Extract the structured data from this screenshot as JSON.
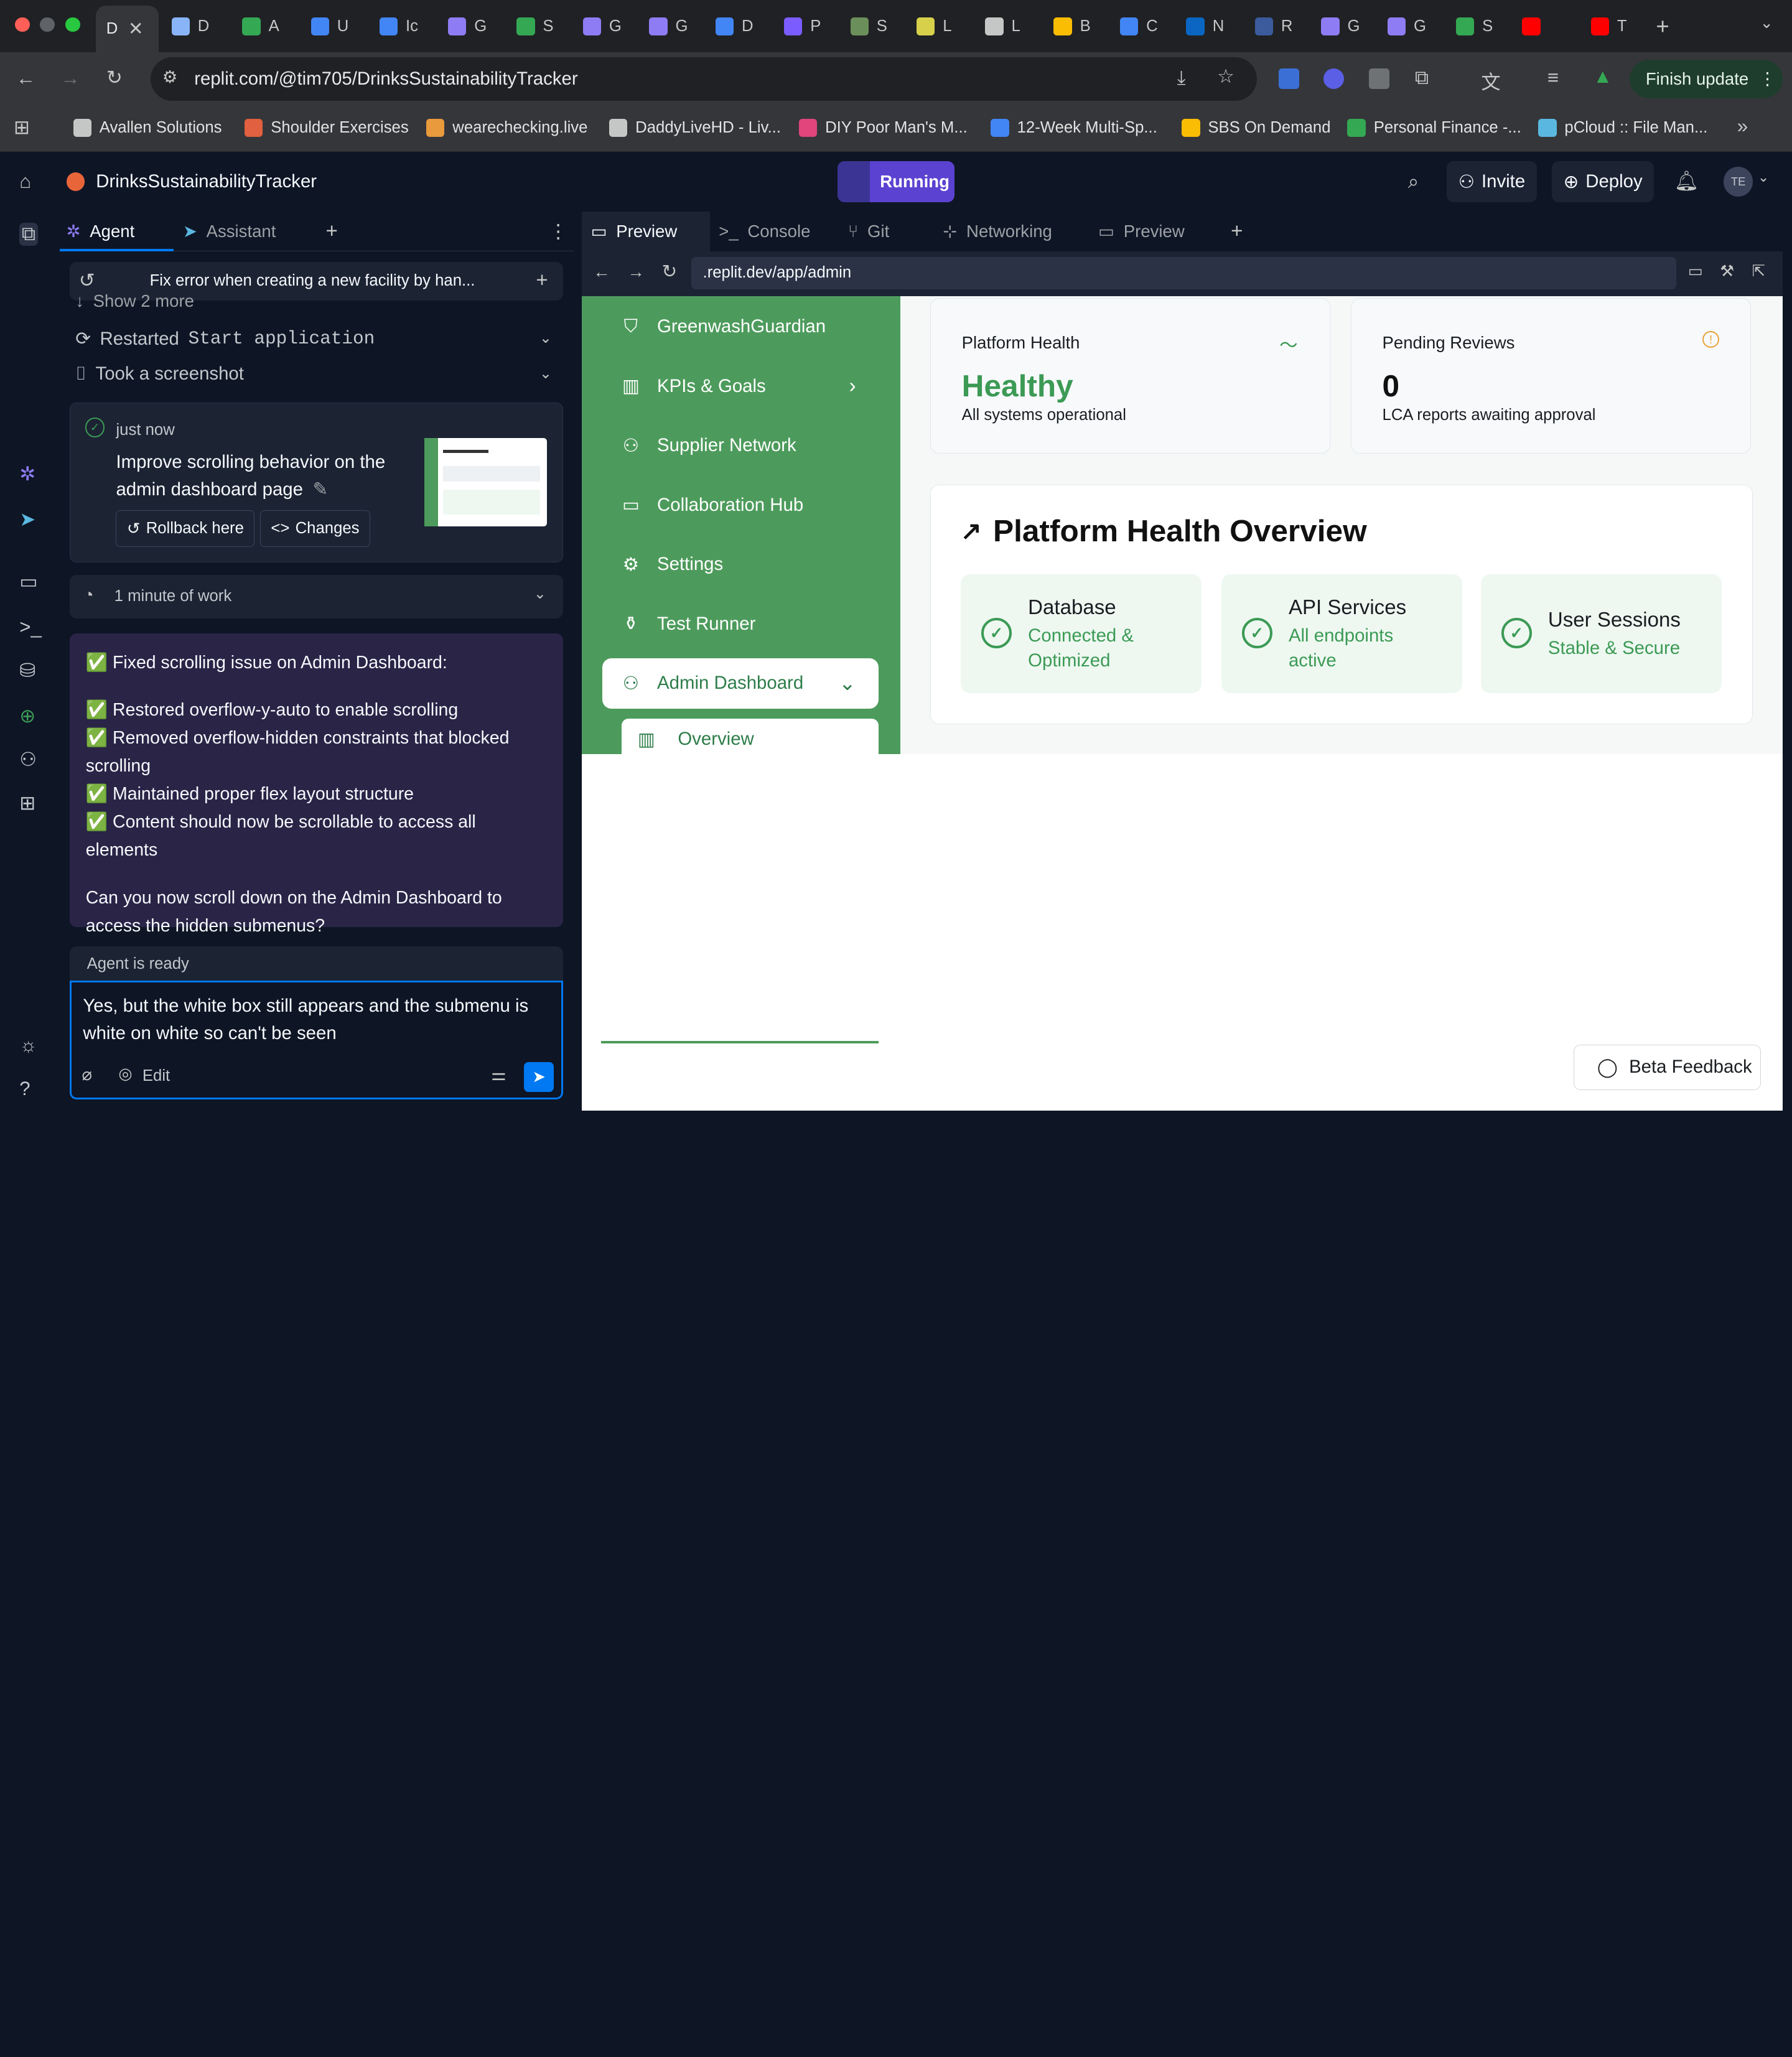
{
  "browser": {
    "tabs": [
      {
        "label": "D",
        "color": "#c4c7c5"
      },
      {
        "label": "D",
        "color": "#8ab4f8"
      },
      {
        "label": "A",
        "color": "#34a853"
      },
      {
        "label": "U",
        "color": "#4285f4"
      },
      {
        "label": "Ic",
        "color": "#4285f4"
      },
      {
        "label": "G",
        "color": "#8e7cf4"
      },
      {
        "label": "S",
        "color": "#34a853"
      },
      {
        "label": "G",
        "color": "#8e7cf4"
      },
      {
        "label": "G",
        "color": "#8e7cf4"
      },
      {
        "label": "D",
        "color": "#4285f4"
      },
      {
        "label": "P",
        "color": "#7b5cff"
      },
      {
        "label": "S",
        "color": "#6b8f5a"
      },
      {
        "label": "L",
        "color": "#d6d04a"
      },
      {
        "label": "L",
        "color": "#c4c7c5"
      },
      {
        "label": "B",
        "color": "#fbbc04"
      },
      {
        "label": "C",
        "color": "#4285f4"
      },
      {
        "label": "N",
        "color": "#0a66c2"
      },
      {
        "label": "R",
        "color": "#3b5b9c"
      },
      {
        "label": "G",
        "color": "#8e7cf4"
      },
      {
        "label": "G",
        "color": "#8e7cf4"
      },
      {
        "label": "S",
        "color": "#34a853"
      },
      {
        "label": "",
        "color": "#ff0000"
      },
      {
        "label": "T",
        "color": "#ff0000"
      }
    ],
    "url": "replit.com/@tim705/DrinksSustainabilityTracker",
    "finish_update": "Finish update",
    "bookmarks": [
      {
        "label": "Avallen Solutions",
        "color": "#c4c7c5"
      },
      {
        "label": "Shoulder Exercises",
        "color": "#e0603f"
      },
      {
        "label": "wearechecking.live",
        "color": "#e89a3c"
      },
      {
        "label": "DaddyLiveHD - Liv...",
        "color": "#c4c7c5"
      },
      {
        "label": "DIY Poor Man's M...",
        "color": "#e0457b"
      },
      {
        "label": "12-Week Multi-Sp...",
        "color": "#4285f4"
      },
      {
        "label": "SBS On Demand",
        "color": "#fbbc04"
      },
      {
        "label": "Personal Finance -...",
        "color": "#34a853"
      },
      {
        "label": "pCloud :: File Man...",
        "color": "#5ab8e0"
      }
    ]
  },
  "replit": {
    "project_name": "DrinksSustainabilityTracker",
    "run_status": "Running",
    "invite": "Invite",
    "deploy": "Deploy",
    "avatar": "TE"
  },
  "agent": {
    "tabs": [
      "Agent",
      "Assistant"
    ],
    "history_title": "Fix error when creating a new facility by han...",
    "show_more": "Show 2 more",
    "actions": [
      {
        "prefix": "Restarted",
        "code": "Start application"
      },
      {
        "prefix": "Took a screenshot",
        "code": ""
      }
    ],
    "checkpoint": {
      "time": "just now",
      "title": "Improve scrolling behavior on the admin dashboard page",
      "rollback": "Rollback here",
      "changes": "Changes"
    },
    "work": "1 minute of work",
    "message": {
      "heading": "✅ Fixed scrolling issue on Admin Dashboard:",
      "bullets": [
        "✅ Restored overflow-y-auto to enable scrolling",
        "✅ Removed overflow-hidden constraints that blocked scrolling",
        "✅ Maintained proper flex layout structure",
        "✅ Content should now be scrollable to access all elements"
      ],
      "question": "Can you now scroll down on the Admin Dashboard to access the hidden submenus?"
    },
    "status": "Agent is ready",
    "input_text": "Yes, but the white box still appears and the submenu is white on white so can't be seen",
    "edit_label": "Edit"
  },
  "preview": {
    "tabs": [
      "Preview",
      "Console",
      "Git",
      "Networking",
      "Preview"
    ],
    "url": ".replit.dev/app/admin",
    "nav": [
      {
        "label": "GreenwashGuardian",
        "icon": "shield-icon",
        "glyph": "⛉"
      },
      {
        "label": "KPIs & Goals",
        "icon": "factory-icon",
        "glyph": "▥",
        "chevron": "›"
      },
      {
        "label": "Supplier Network",
        "icon": "users-icon",
        "glyph": "⚇"
      },
      {
        "label": "Collaboration Hub",
        "icon": "chat-icon",
        "glyph": "▭"
      },
      {
        "label": "Settings",
        "icon": "gear-icon",
        "glyph": "⚙"
      },
      {
        "label": "Test Runner",
        "icon": "flask-icon",
        "glyph": "⚱"
      },
      {
        "label": "Admin Dashboard",
        "icon": "users-icon",
        "glyph": "⚇",
        "chevron": "⌄"
      }
    ],
    "submenu": {
      "label": "Overview"
    },
    "stats": [
      {
        "heading": "Platform Health",
        "value": "Healthy",
        "sub": "All systems operational",
        "value_color": "#3c9a55",
        "icon_color": "#3c9a55"
      },
      {
        "heading": "Pending Reviews",
        "value": "0",
        "sub": "LCA reports awaiting approval",
        "value_color": "#111111",
        "icon_color": "#e8a33b"
      }
    ],
    "overview_title": "Platform Health Overview",
    "health": [
      {
        "name": "Database",
        "desc": "Connected & Optimized"
      },
      {
        "name": "API Services",
        "desc": "All endpoints active"
      },
      {
        "name": "User Sessions",
        "desc": "Stable & Secure"
      }
    ],
    "feedback": "Beta Feedback"
  }
}
